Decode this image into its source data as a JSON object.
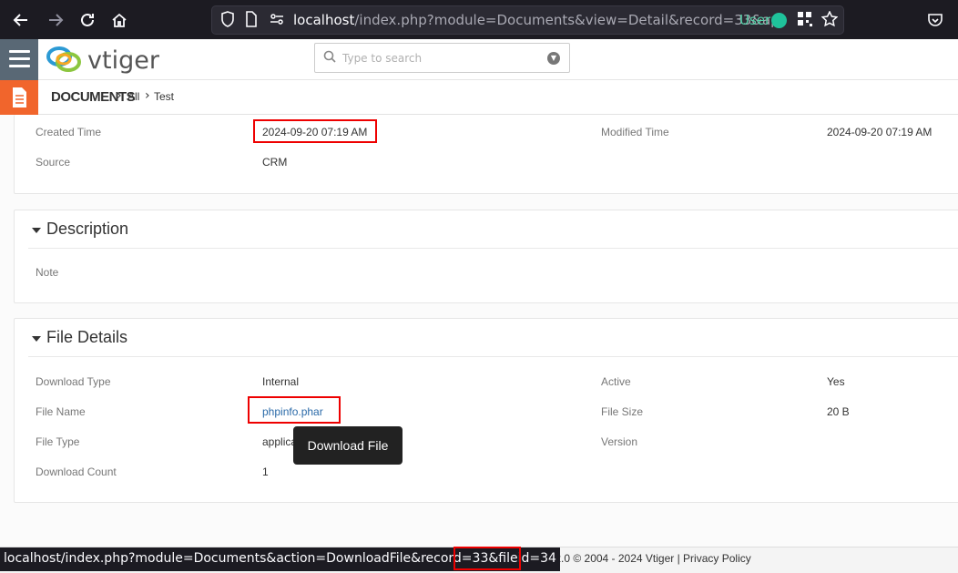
{
  "browser": {
    "url_host": "localhost",
    "url_rest": "/index.php?module=Documents&view=Detail&record=33&ap",
    "user_label": "User",
    "status_url": "localhost/index.php?module=Documents&action=DownloadFile&record=33&fileid=34"
  },
  "header": {
    "logo_text": "vtiger",
    "search_placeholder": "Type to search"
  },
  "breadcrumb": {
    "module": "DOCUMENTS",
    "items": [
      "All",
      "Test"
    ]
  },
  "details_top": {
    "created_time_label": "Created Time",
    "created_time_value": "2024-09-20 07:19 AM",
    "modified_time_label": "Modified Time",
    "modified_time_value": "2024-09-20 07:19 AM",
    "source_label": "Source",
    "source_value": "CRM"
  },
  "description": {
    "title": "Description",
    "note_label": "Note"
  },
  "file_details": {
    "title": "File Details",
    "download_type_label": "Download Type",
    "download_type_value": "Internal",
    "active_label": "Active",
    "active_value": "Yes",
    "file_name_label": "File Name",
    "file_name_value": "phpinfo.phar",
    "file_size_label": "File Size",
    "file_size_value": "20 B",
    "file_type_label": "File Type",
    "file_type_value": "applicati",
    "version_label": "Version",
    "download_count_label": "Download Count",
    "download_count_value": "1"
  },
  "tooltip": {
    "text": "Download File"
  },
  "footer": {
    "text": "RM - 8.2.0  © 2004 - 2024   Vtiger |   Privacy Policy"
  },
  "colors": {
    "chrome_bg": "#1c1b22",
    "menu_bg": "#596875",
    "module_accent": "#f1652c",
    "highlight_red": "#ee0000",
    "user_green": "#1fc29b"
  }
}
